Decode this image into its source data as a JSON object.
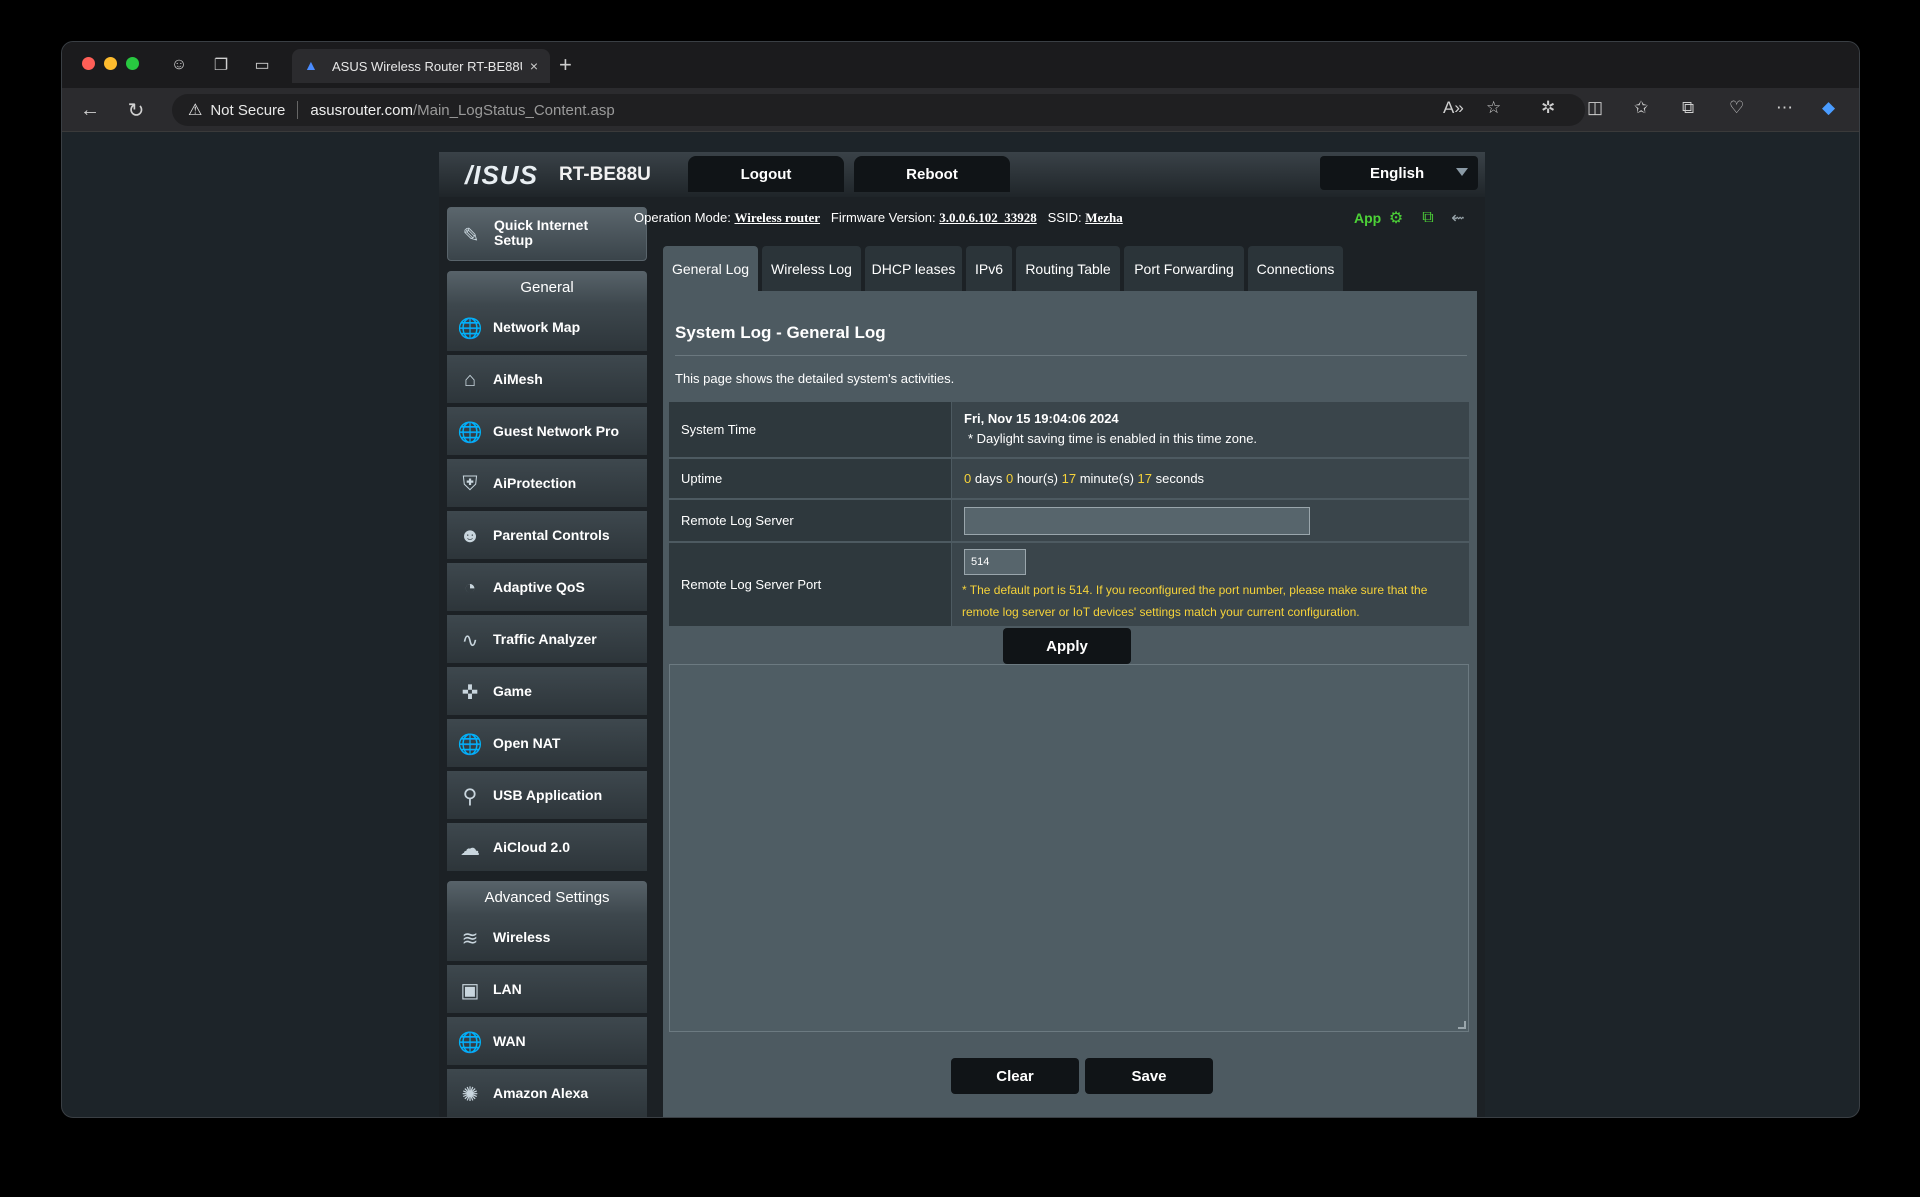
{
  "browser": {
    "tab_title": "ASUS Wireless Router RT-BE88U",
    "tab_close": "×",
    "new_tab": "+",
    "security_label": "Not Secure",
    "url_host": "asusrouter.com",
    "url_path": "/Main_LogStatus_Content.asp"
  },
  "header": {
    "logo": "/ISUS",
    "model": "RT-BE88U",
    "logout_label": "Logout",
    "reboot_label": "Reboot",
    "language": "English"
  },
  "sidebar": {
    "quick_setup_label": "Quick Internet Setup",
    "general_header": "General",
    "general_items": [
      {
        "label": "Network Map",
        "icon": "globe-icon"
      },
      {
        "label": "AiMesh",
        "icon": "mesh-icon"
      },
      {
        "label": "Guest Network Pro",
        "icon": "globe-icon"
      },
      {
        "label": "AiProtection",
        "icon": "shield-icon"
      },
      {
        "label": "Parental Controls",
        "icon": "family-icon"
      },
      {
        "label": "Adaptive QoS",
        "icon": "gauge-icon"
      },
      {
        "label": "Traffic Analyzer",
        "icon": "pulse-icon"
      },
      {
        "label": "Game",
        "icon": "gamepad-icon"
      },
      {
        "label": "Open NAT",
        "icon": "globe-icon"
      },
      {
        "label": "USB Application",
        "icon": "usb-icon"
      },
      {
        "label": "AiCloud 2.0",
        "icon": "cloud-icon"
      }
    ],
    "advanced_header": "Advanced Settings",
    "advanced_items": [
      {
        "label": "Wireless",
        "icon": "wifi-icon"
      },
      {
        "label": "LAN",
        "icon": "monitor-icon"
      },
      {
        "label": "WAN",
        "icon": "globe-icon"
      },
      {
        "label": "Amazon Alexa",
        "icon": "alexa-icon"
      }
    ]
  },
  "status": {
    "op_mode_label": "Operation Mode:",
    "op_mode_value": "Wireless router",
    "firmware_label": "Firmware Version:",
    "firmware_value": "3.0.0.6.102_33928",
    "ssid_label": "SSID:",
    "ssid_value": "Mezha",
    "app_label": "App"
  },
  "tabs": [
    "General Log",
    "Wireless Log",
    "DHCP leases",
    "IPv6",
    "Routing Table",
    "Port Forwarding",
    "Connections"
  ],
  "panel": {
    "title": "System Log - General Log",
    "description": "This page shows the detailed system's activities.",
    "system_time_label": "System Time",
    "system_time_value": "Fri, Nov 15 19:04:06 2024",
    "dst_note": "* Daylight saving time is enabled in this time zone.",
    "uptime_label": "Uptime",
    "uptime": {
      "days": "0",
      "days_unit": "days",
      "hours": "0",
      "hours_unit": "hour(s)",
      "minutes": "17",
      "minutes_unit": "minute(s)",
      "seconds": "17",
      "seconds_unit": "seconds"
    },
    "remote_log_server_label": "Remote Log Server",
    "remote_log_server_value": "",
    "remote_log_port_label": "Remote Log Server Port",
    "remote_log_port_value": "514",
    "port_note": "* The default port is 514. If you reconfigured the port number, please make sure that the remote log server or IoT devices' settings match your current configuration.",
    "apply_label": "Apply",
    "clear_label": "Clear",
    "save_label": "Save",
    "log_text": ""
  }
}
